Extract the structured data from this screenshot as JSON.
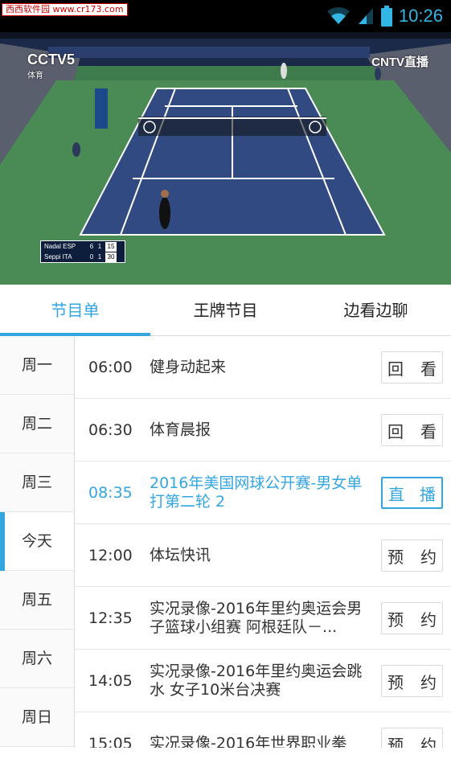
{
  "status_bar": {
    "watermark": "西西软件园 www.cr173.com",
    "time": "10:26",
    "icons": [
      "wifi-icon",
      "signal-icon",
      "battery-icon"
    ],
    "accent": "#33b5e5"
  },
  "video": {
    "channel_logo": "CCTV5",
    "channel_sub": "体育",
    "cntv_logo": "CNTV直播",
    "scoreboard": {
      "rows": [
        {
          "name": "Nadal ESP",
          "s1": "6",
          "s2": "1",
          "pts": "15"
        },
        {
          "name": "Seppi ITA",
          "s1": "0",
          "s2": "1",
          "pts": "30"
        }
      ]
    }
  },
  "tabs": [
    {
      "label": "节目单",
      "active": true
    },
    {
      "label": "王牌节目",
      "active": false
    },
    {
      "label": "边看边聊",
      "active": false
    }
  ],
  "days": [
    {
      "label": "周一"
    },
    {
      "label": "周二"
    },
    {
      "label": "周三"
    },
    {
      "label": "今天",
      "active": true
    },
    {
      "label": "周五"
    },
    {
      "label": "周六"
    },
    {
      "label": "周日"
    }
  ],
  "programs": [
    {
      "time": "06:00",
      "title": "健身动起来",
      "button": [
        "回",
        "看"
      ],
      "state": "replay"
    },
    {
      "time": "06:30",
      "title": "体育晨报",
      "button": [
        "回",
        "看"
      ],
      "state": "replay"
    },
    {
      "time": "08:35",
      "title": "2016年美国网球公开赛-男女单打第二轮 2",
      "button": [
        "直",
        "播"
      ],
      "state": "live"
    },
    {
      "time": "12:00",
      "title": "体坛快讯",
      "button": [
        "预",
        "约"
      ],
      "state": "reserve"
    },
    {
      "time": "12:35",
      "title": "实况录像-2016年里约奥运会男子篮球小组赛 阿根廷队－...",
      "button": [
        "预",
        "约"
      ],
      "state": "reserve"
    },
    {
      "time": "14:05",
      "title": "实况录像-2016年里约奥运会跳水 女子10米台决赛",
      "button": [
        "预",
        "约"
      ],
      "state": "reserve"
    },
    {
      "time": "15:05",
      "title": "实况录像-2016年世界职业拳",
      "button": [
        "预",
        "约"
      ],
      "state": "reserve"
    }
  ],
  "colors": {
    "accent": "#33a6e0",
    "text": "#333333",
    "divider": "#e6e6e6"
  }
}
